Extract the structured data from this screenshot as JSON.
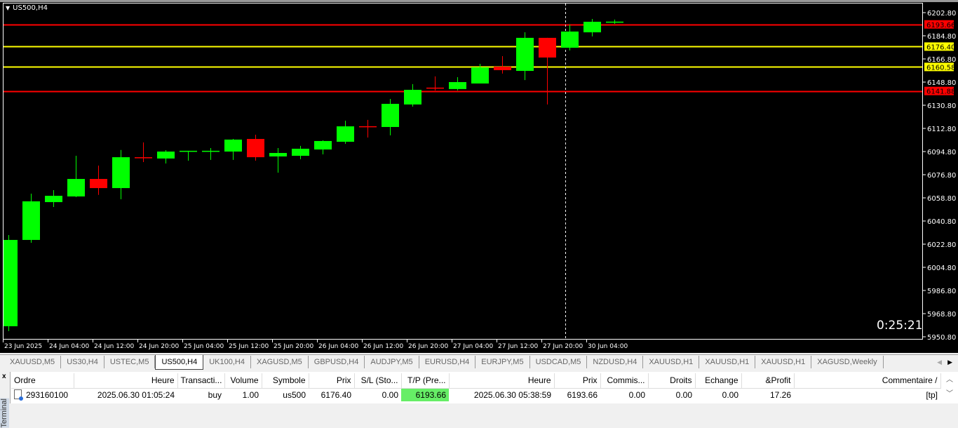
{
  "chart": {
    "symbol": "US500,H4",
    "timer": "0:25:21",
    "colors": {
      "bull": "#00ff00",
      "bear": "#ff0000",
      "tp_line": "#ff0000",
      "entry_line": "#ffff00"
    },
    "price_labels": [
      "6202.80",
      "6184.80",
      "6166.80",
      "6148.80",
      "6130.80",
      "6112.80",
      "6094.80",
      "6076.80",
      "6058.80",
      "6040.80",
      "6022.80",
      "6004.80",
      "5986.80",
      "5968.80",
      "5950.80"
    ],
    "time_labels": [
      "23 Jun 2025",
      "24 Jun 04:00",
      "24 Jun 12:00",
      "24 Jun 20:00",
      "25 Jun 04:00",
      "25 Jun 12:00",
      "25 Jun 20:00",
      "26 Jun 04:00",
      "26 Jun 12:00",
      "26 Jun 20:00",
      "27 Jun 04:00",
      "27 Jun 12:00",
      "27 Jun 20:00",
      "30 Jun 04:00"
    ],
    "hlines": [
      {
        "price": 6193.66,
        "label": "6193.66",
        "color": "#ff0000"
      },
      {
        "price": 6176.4,
        "label": "6176.40",
        "color": "#ffff00"
      },
      {
        "price": 6160.58,
        "label": "6160.58",
        "color": "#ffff00"
      },
      {
        "price": 6141.88,
        "label": "6141.88",
        "color": "#ff0000"
      }
    ]
  },
  "chart_data": {
    "type": "candlestick",
    "title": "US500,H4",
    "ylim": [
      5950.8,
      6202.8
    ],
    "ohlc": [
      [
        5959.0,
        6029.9,
        5955.2,
        6026.1
      ],
      [
        6026.1,
        6062.1,
        6023.9,
        6056.1
      ],
      [
        6055.5,
        6064.8,
        6051.7,
        6060.4
      ],
      [
        6059.9,
        6091.5,
        6059.4,
        6073.5
      ],
      [
        6073.5,
        6083.9,
        6061.1,
        6066.4
      ],
      [
        6066.4,
        6096.0,
        6057.7,
        6090.4
      ],
      [
        6090.4,
        6101.9,
        6086.6,
        6090.2
      ],
      [
        6089.4,
        6095.9,
        6085.5,
        6094.8
      ],
      [
        6095.0,
        6095.4,
        6087.7,
        6095.4
      ],
      [
        6095.2,
        6097.5,
        6088.3,
        6095.4
      ],
      [
        6094.8,
        6104.6,
        6088.3,
        6104.1
      ],
      [
        6104.6,
        6107.9,
        6087.7,
        6090.4
      ],
      [
        6091.0,
        6097.5,
        6078.4,
        6093.7
      ],
      [
        6091.5,
        6099.2,
        6088.9,
        6097.0
      ],
      [
        6096.4,
        6103.5,
        6092.6,
        6103.0
      ],
      [
        6102.4,
        6118.8,
        6100.8,
        6114.4
      ],
      [
        6114.5,
        6119.4,
        6105.7,
        6114.4
      ],
      [
        6113.9,
        6135.7,
        6107.4,
        6131.9
      ],
      [
        6131.4,
        6147.2,
        6129.7,
        6142.8
      ],
      [
        6144.5,
        6153.2,
        6142.3,
        6144.4
      ],
      [
        6143.4,
        6152.6,
        6142.3,
        6148.8
      ],
      [
        6147.7,
        6163.0,
        6147.7,
        6160.3
      ],
      [
        6160.8,
        6169.0,
        6155.4,
        6158.1
      ],
      [
        6157.5,
        6187.5,
        6150.4,
        6183.2
      ],
      [
        6183.2,
        6183.2,
        6131.4,
        6167.9
      ],
      [
        6175.5,
        6193.5,
        6173.4,
        6188.1
      ],
      [
        6187.5,
        6197.9,
        6184.3,
        6195.7
      ],
      [
        6195.7,
        6197.4,
        6194.1,
        6195.8
      ]
    ]
  },
  "tabs": [
    "XAUUSD,M5",
    "US30,H4",
    "USTEC,M5",
    "US500,H4",
    "UK100,H4",
    "XAGUSD,M5",
    "GBPUSD,H4",
    "AUDJPY,M5",
    "EURUSD,H4",
    "EURJPY,M5",
    "USDCAD,M5",
    "NZDUSD,H4",
    "XAUUSD,H1",
    "XAUUSD,H1",
    "XAUUSD,H1",
    "XAGUSD,Weekly"
  ],
  "active_tab": 3,
  "terminal": {
    "side_label": "Terminal",
    "close": "x",
    "headers": [
      "Ordre",
      "Heure",
      "Transacti...",
      "Volume",
      "Symbole",
      "Prix",
      "S/L (Sto...",
      "T/P (Pre...",
      "Heure",
      "Prix",
      "Commis...",
      "Droits",
      "Echange",
      "&Profit",
      "Commentaire  /"
    ],
    "rows": [
      [
        "293160100",
        "2025.06.30 01:05:24",
        "buy",
        "1.00",
        "us500",
        "6176.40",
        "0.00",
        "6193.66",
        "2025.06.30 05:38:59",
        "6193.66",
        "0.00",
        "0.00",
        "0.00",
        "17.26",
        "[tp]"
      ]
    ]
  }
}
